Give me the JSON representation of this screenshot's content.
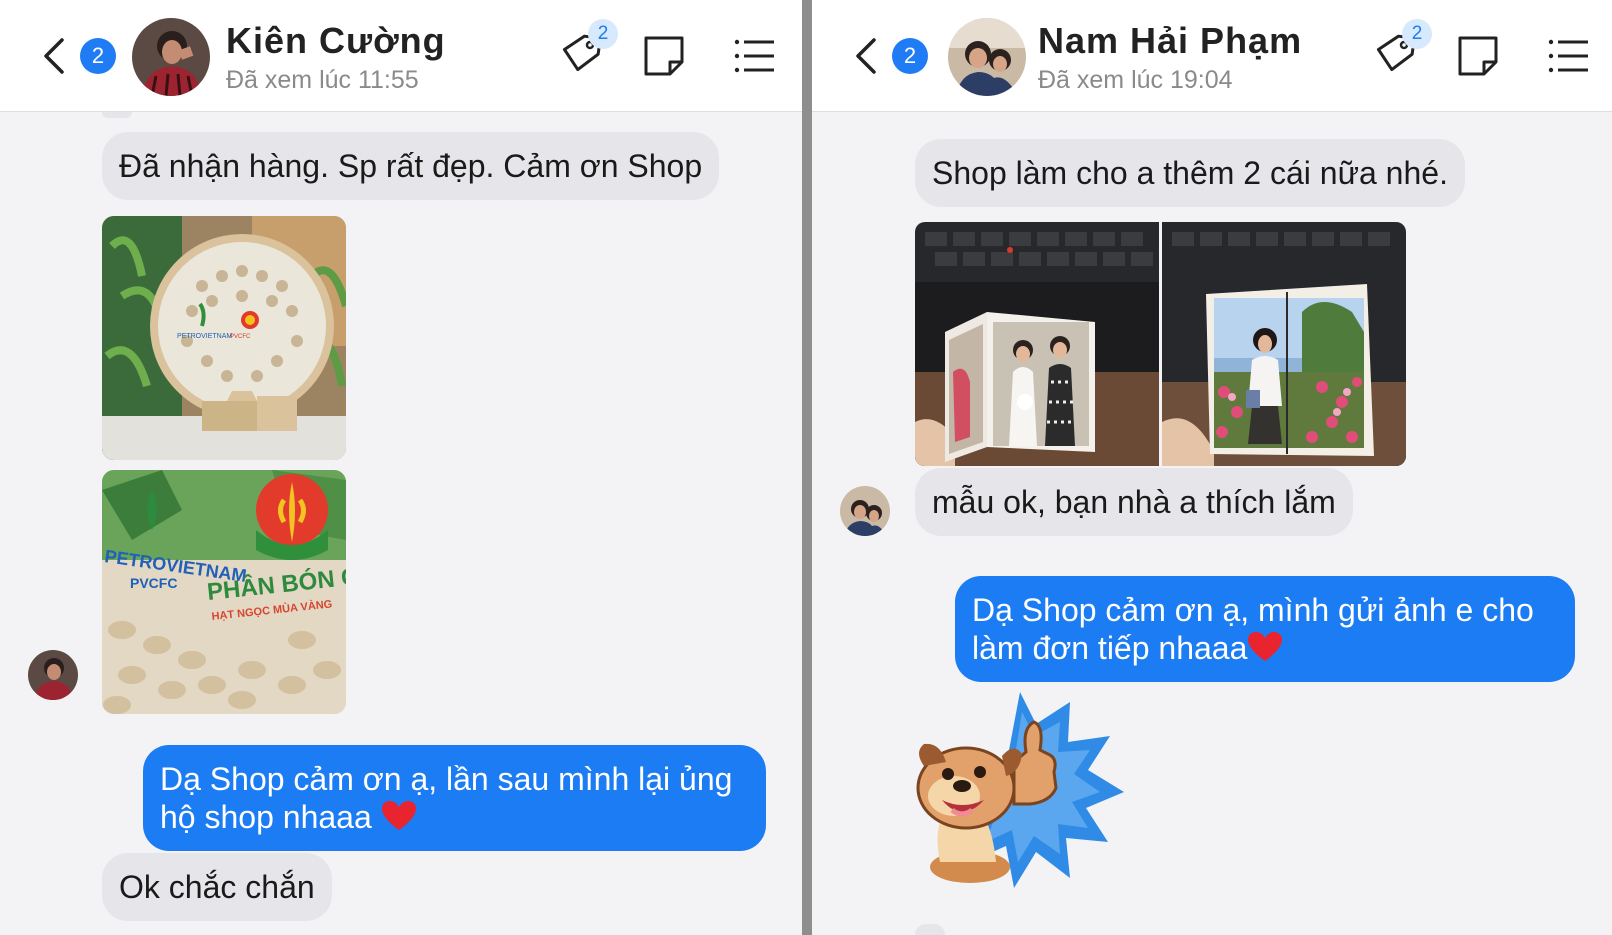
{
  "left": {
    "unread_count": "2",
    "contact_name": "Kiên Cường",
    "seen_status": "Đã xem lúc 11:55",
    "tag_count": "2",
    "messages": {
      "received_1": "Đã nhận hàng. Sp rất đẹp. Cảm ơn Shop",
      "sent_1": "Dạ Shop cảm ơn ạ, lần sau mình lại ủng hộ shop nhaaa ",
      "received_2": "Ok chắc chắn"
    },
    "photo_1_lettering": [
      "PETROVIETNAM",
      "PVCFC"
    ],
    "photo_2_lettering": [
      "PETROVIETNAM",
      "PVCFC",
      "PHÂN BÓN CÀ MAU",
      "HẠT NGỌC MÙA VÀNG"
    ]
  },
  "right": {
    "unread_count": "2",
    "contact_name": "Nam Hải Phạm",
    "seen_status": "Đã xem lúc 19:04",
    "tag_count": "2",
    "messages": {
      "received_1": "Shop làm cho a thêm 2 cái nữa nhé.",
      "received_2": "mẫu ok, bạn nhà a thích lắm",
      "sent_1": "Dạ Shop cảm ơn ạ, mình gửi ảnh e cho làm đơn tiếp nhaaa"
    }
  },
  "colors": {
    "sent_bubble": "#1c7cf4",
    "received_bubble": "#e6e6ea",
    "badge": "#1f7cf5",
    "chat_background": "#f3f3f5",
    "heart": "#e8242f"
  },
  "icons": [
    "back-chevron-icon",
    "tag-icon",
    "note-icon",
    "list-menu-icon",
    "heart-icon",
    "thumbs-up-dog-sticker"
  ]
}
